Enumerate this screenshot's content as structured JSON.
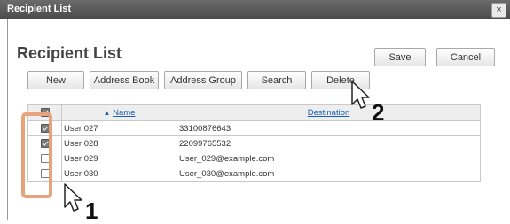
{
  "window": {
    "title": "Recipient List",
    "close_glyph": "×"
  },
  "heading": "Recipient List",
  "actions": {
    "save": "Save",
    "cancel": "Cancel"
  },
  "toolbar": {
    "new": "New",
    "address_book": "Address Book",
    "address_group": "Address Group",
    "search": "Search",
    "delete": "Delete"
  },
  "table": {
    "header": {
      "name": "Name",
      "destination": "Destination",
      "sort_indicator": "▲"
    },
    "rows": [
      {
        "checked": true,
        "name": "User 027",
        "destination": "33100876643"
      },
      {
        "checked": true,
        "name": "User 028",
        "destination": "22099765532"
      },
      {
        "checked": false,
        "name": "User 029",
        "destination": "User_029@example.com"
      },
      {
        "checked": false,
        "name": "User 030",
        "destination": "User_030@example.com"
      }
    ]
  },
  "callouts": {
    "one": "1",
    "two": "2"
  },
  "colors": {
    "highlight": "#e8a27c",
    "link": "#1a5fb4",
    "titlebar": "#555555"
  }
}
